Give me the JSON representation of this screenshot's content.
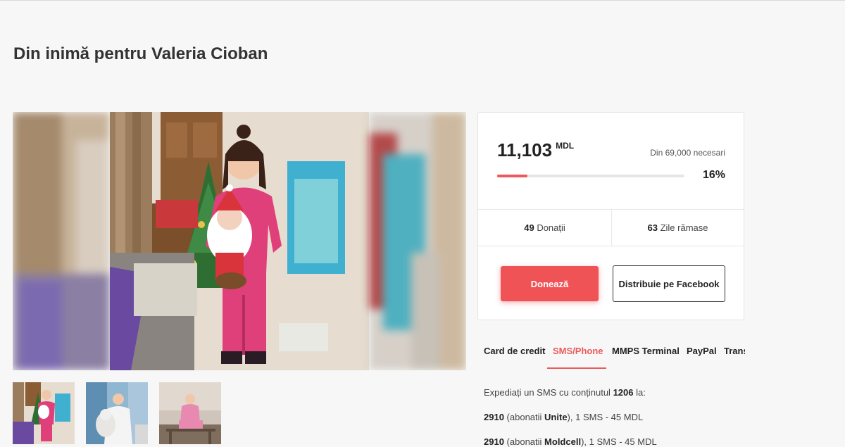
{
  "page": {
    "title": "Din inimă pentru Valeria Cioban"
  },
  "gallery": {
    "main_alt": "Photo of a child in pink holding a Santa toy",
    "thumbnails": [
      "thumb-1",
      "thumb-2",
      "thumb-3"
    ]
  },
  "donation": {
    "amount": "11,103",
    "currency": "MDL",
    "goal_text": "Din 69,000 necesari",
    "progress_fraction": 0.16,
    "percent_text": "16%",
    "donations_count": "49",
    "donations_label": "Donații",
    "days_count": "63",
    "days_label": "Zile rămase",
    "donate_label": "Donează",
    "share_label": "Distribuie pe Facebook"
  },
  "tabs": [
    {
      "label": "Card de credit"
    },
    {
      "label": "SMS/Phone"
    },
    {
      "label": "MMPS Terminal"
    },
    {
      "label": "PayPal"
    },
    {
      "label": "Trans"
    }
  ],
  "sms": {
    "intro_prefix": "Expediați un SMS cu conținutul",
    "code": "1206",
    "intro_suffix": "la:",
    "lines": [
      {
        "number": "2910",
        "pre": "(abonatii",
        "operator": "Unite",
        "post": "), 1 SMS - 45 MDL"
      },
      {
        "number": "2910",
        "pre": "(abonatii",
        "operator": "Moldcell",
        "post": "), 1 SMS - 45 MDL"
      }
    ]
  },
  "colors": {
    "accent": "#ec5a5c",
    "button": "#f05356",
    "background": "#f7f7f7"
  }
}
